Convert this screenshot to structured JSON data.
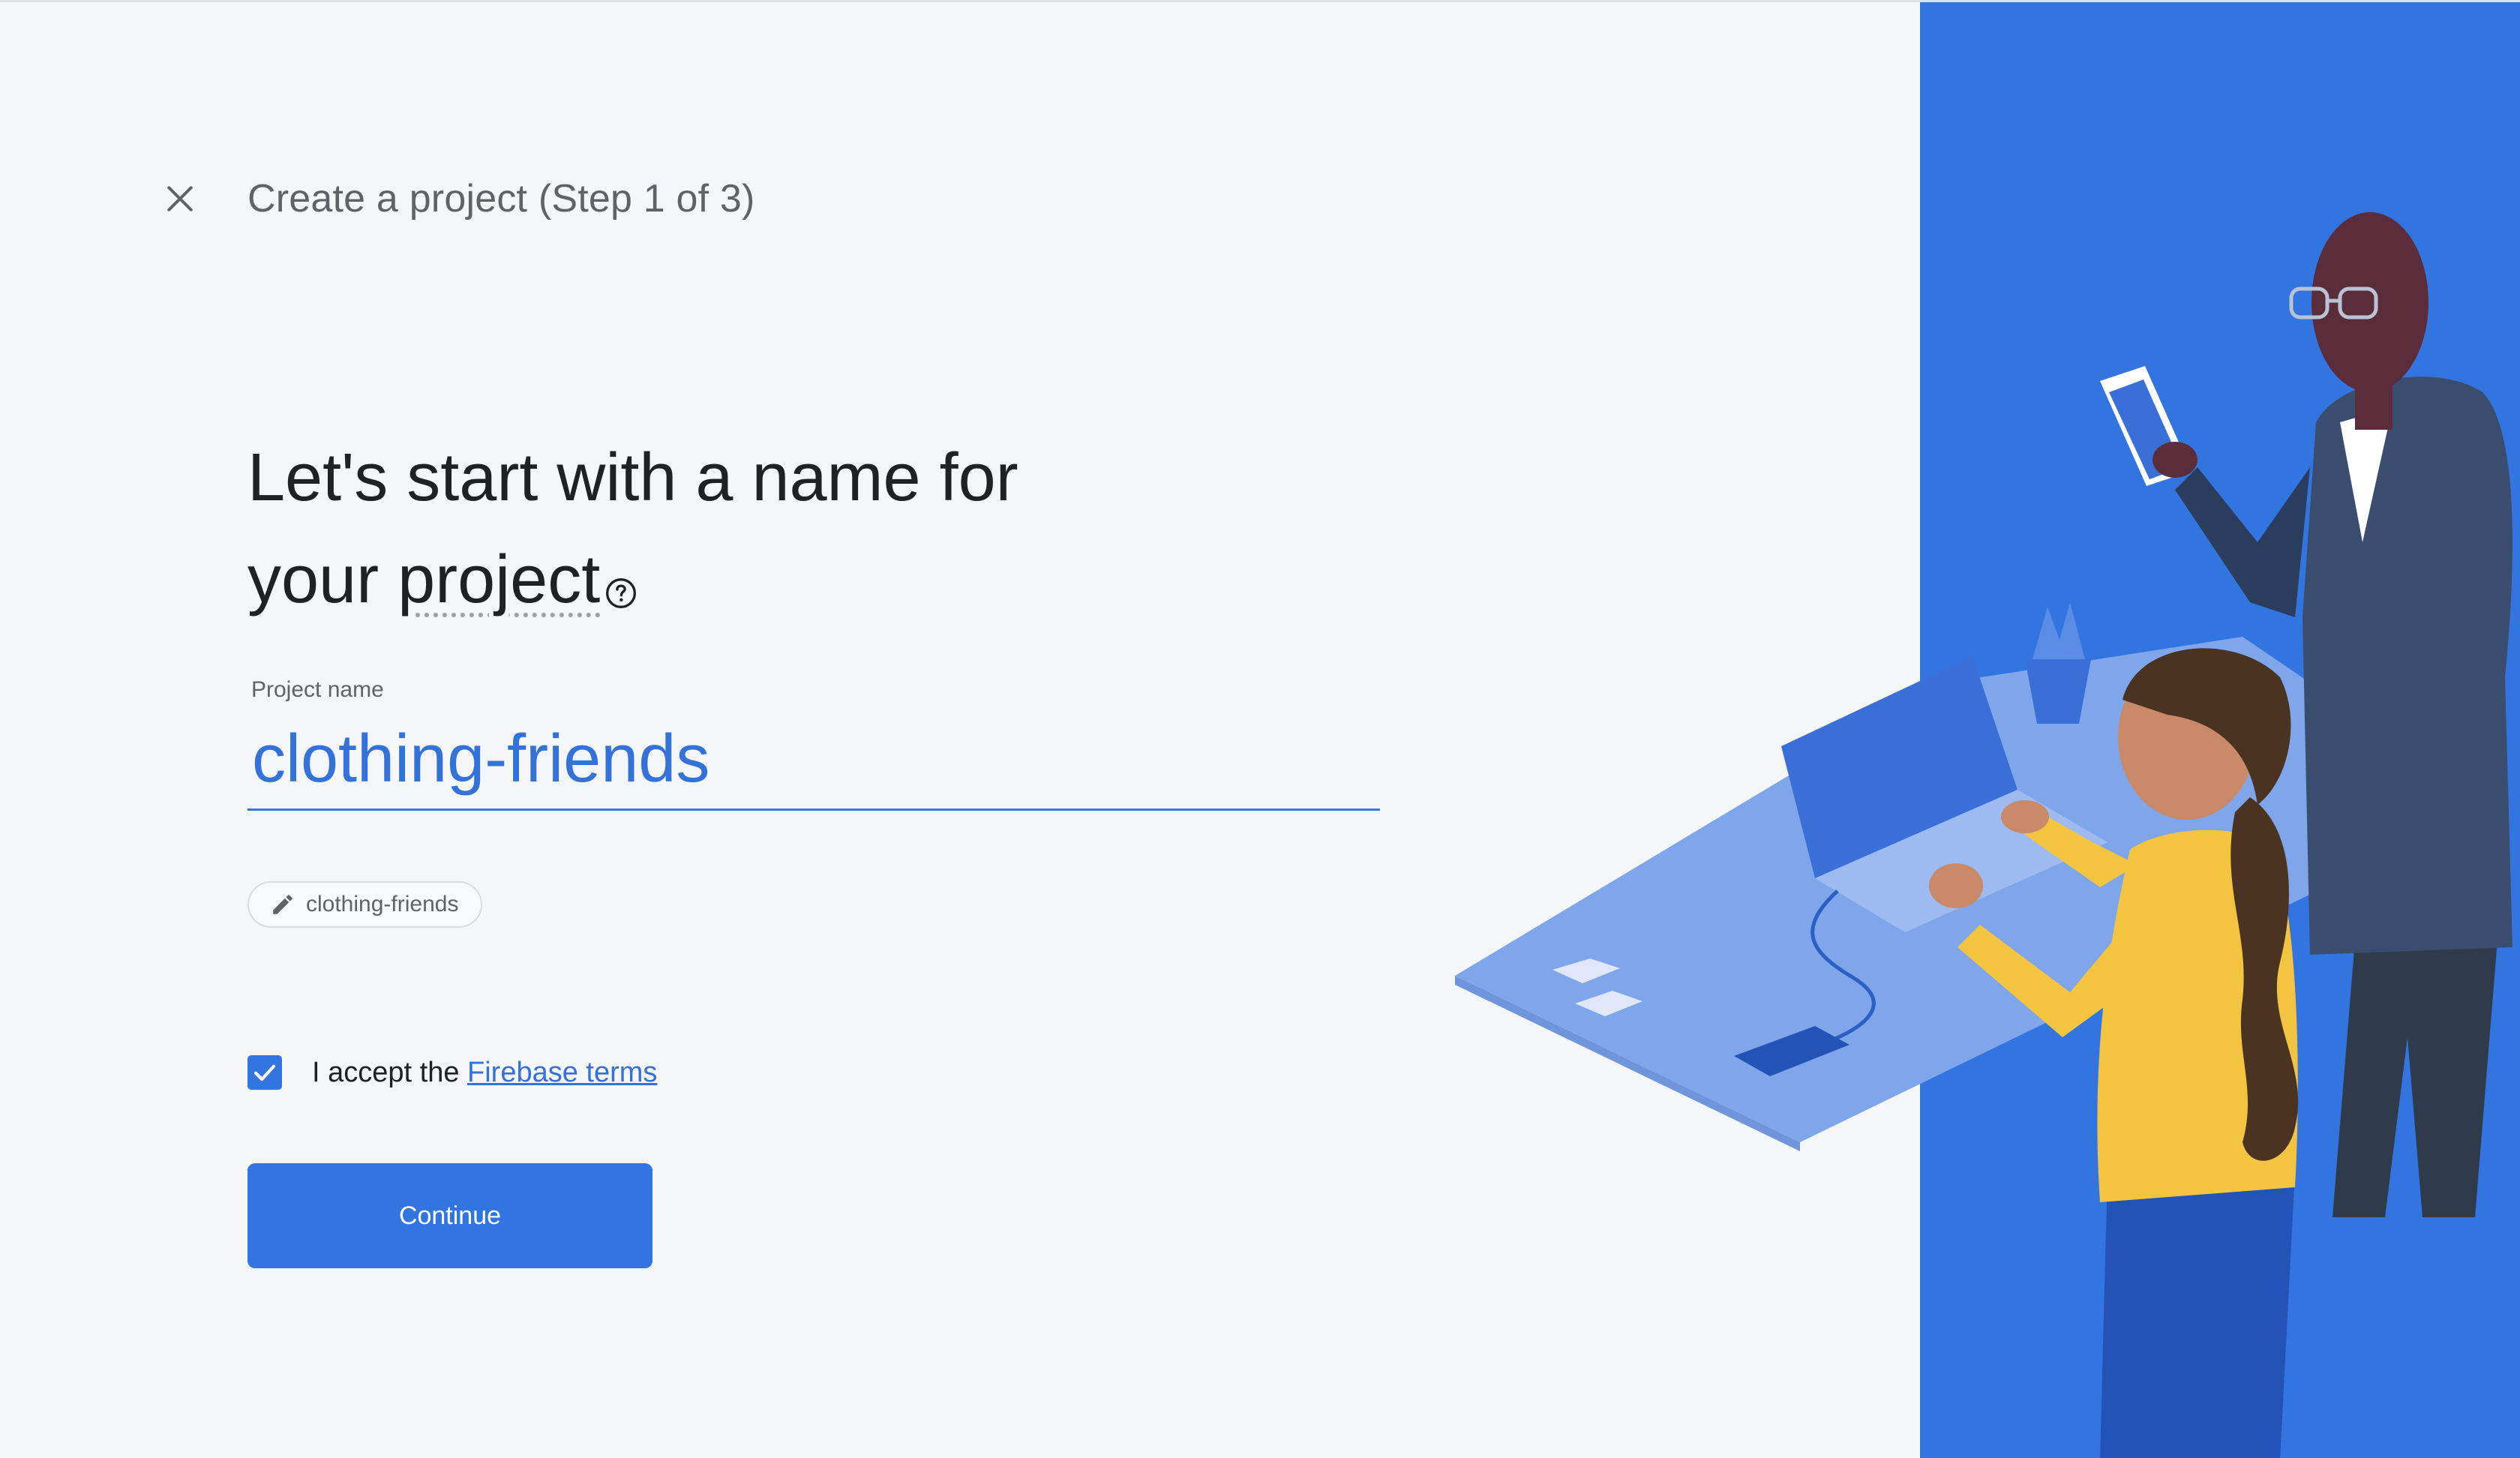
{
  "header": {
    "title": "Create a project (Step 1 of 3)",
    "close_icon": "close-icon"
  },
  "heading": {
    "line1": "Let's start with a name for",
    "line2_prefix": "your ",
    "line2_term": "project",
    "help_icon": "help-circle-icon"
  },
  "project_name": {
    "label": "Project name",
    "value": "clothing-friends"
  },
  "project_id_chip": {
    "icon": "pencil-icon",
    "value": "clothing-friends"
  },
  "terms": {
    "checked": true,
    "prefix": "I accept the ",
    "link": "Firebase terms"
  },
  "actions": {
    "continue_label": "Continue"
  },
  "colors": {
    "accent": "#3375e0",
    "background": "#f5f6f8",
    "text_primary": "#202124",
    "text_secondary": "#5f6368"
  }
}
